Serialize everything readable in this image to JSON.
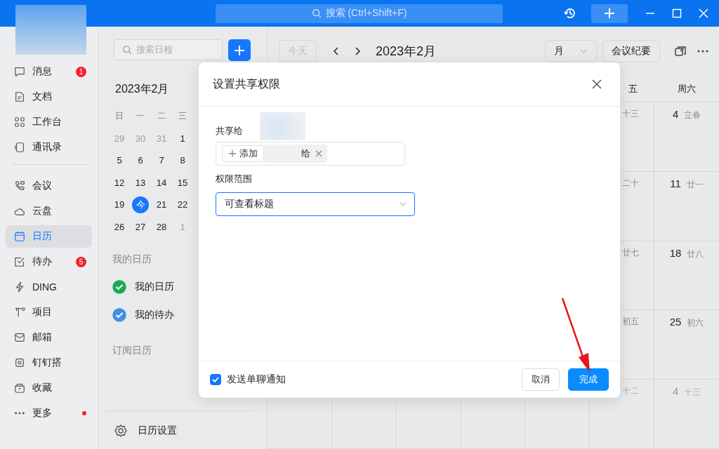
{
  "title_bar": {
    "search_placeholder": "搜索 (Ctrl+Shift+F)"
  },
  "nav_groups": [
    [
      {
        "label": "消息",
        "selected": false,
        "badge": "1",
        "dot": false
      },
      {
        "label": "文档",
        "selected": false,
        "dot": false
      },
      {
        "label": "工作台",
        "selected": false,
        "dot": false
      },
      {
        "label": "通讯录",
        "selected": false,
        "dot": false
      }
    ],
    [
      {
        "label": "会议",
        "selected": false,
        "dot": false
      },
      {
        "label": "云盘",
        "selected": false,
        "dot": false
      },
      {
        "label": "日历",
        "selected": true,
        "dot": false
      },
      {
        "label": "待办",
        "selected": false,
        "badge": "5",
        "dot": false
      },
      {
        "label": "DING",
        "selected": false,
        "dot": false
      },
      {
        "label": "项目",
        "selected": false,
        "dot": false
      },
      {
        "label": "邮箱",
        "selected": false,
        "dot": false
      },
      {
        "label": "钉钉搭",
        "selected": false,
        "dot": false
      },
      {
        "label": "收藏",
        "selected": false,
        "dot": false
      },
      {
        "label": "更多",
        "selected": false,
        "dot": true
      }
    ]
  ],
  "side_panel": {
    "search_placeholder": "搜索日程",
    "mini_calendar": {
      "title": "2023年2月",
      "weekdays": [
        "日",
        "一",
        "二",
        "三"
      ],
      "weeks": [
        [
          {
            "day": "29",
            "muted": true,
            "today": false
          },
          {
            "day": "30",
            "muted": true,
            "today": false
          },
          {
            "day": "31",
            "muted": true,
            "today": false
          },
          {
            "day": "1",
            "muted": false,
            "today": false
          }
        ],
        [
          {
            "day": "5",
            "muted": false,
            "today": false
          },
          {
            "day": "6",
            "muted": false,
            "today": false
          },
          {
            "day": "7",
            "muted": false,
            "today": false
          },
          {
            "day": "8",
            "muted": false,
            "today": false
          }
        ],
        [
          {
            "day": "12",
            "muted": false,
            "today": false
          },
          {
            "day": "13",
            "muted": false,
            "today": false
          },
          {
            "day": "14",
            "muted": false,
            "today": false
          },
          {
            "day": "15",
            "muted": false,
            "today": false
          }
        ],
        [
          {
            "day": "19",
            "muted": false,
            "today": false
          },
          {
            "day": "今",
            "muted": false,
            "today": true
          },
          {
            "day": "21",
            "muted": false,
            "today": false
          },
          {
            "day": "22",
            "muted": false,
            "today": false
          }
        ],
        [
          {
            "day": "26",
            "muted": false,
            "today": false
          },
          {
            "day": "27",
            "muted": false,
            "today": false
          },
          {
            "day": "28",
            "muted": false,
            "today": false
          },
          {
            "day": "1",
            "muted": true,
            "today": false
          }
        ]
      ]
    },
    "my_heading": "我的日历",
    "calendars": [
      {
        "label": "我的日历",
        "checked": true,
        "color": "#1bab56"
      },
      {
        "label": "我的待办",
        "checked": true,
        "color": "#3d8fe8"
      }
    ],
    "subscribed_heading": "订阅日历",
    "settings_label": "日历设置"
  },
  "toolbar": {
    "today": "今天",
    "title": "2023年2月",
    "view": "月",
    "minutes": "会议纪要"
  },
  "grid": {
    "headers": [
      "五",
      "周六"
    ],
    "rows": [
      {
        "cells": [
          {
            "lunar": "十三",
            "muted": false
          },
          {
            "date": "4",
            "lunar": "立春",
            "muted": false
          }
        ]
      },
      {
        "cells": [
          {
            "lunar": "二十",
            "muted": false
          },
          {
            "date": "11",
            "lunar": "廿一",
            "muted": false
          }
        ]
      },
      {
        "cells": [
          {
            "lunar": "廿七",
            "muted": false
          },
          {
            "date": "18",
            "lunar": "廿八",
            "muted": false
          }
        ]
      },
      {
        "cells": [
          {
            "lunar": "初五",
            "muted": false
          },
          {
            "date": "25",
            "lunar": "初六",
            "muted": false
          }
        ]
      },
      {
        "cells": [
          {
            "lunar": "十二",
            "muted": true
          },
          {
            "date": "4",
            "lunar": "十三",
            "muted": true
          }
        ]
      }
    ]
  },
  "dialog": {
    "title": "设置共享权限",
    "share_label": "共享给",
    "add_label": "添加",
    "chip_text": "给",
    "scope_label": "权限范围",
    "scope_value": "可查看标题",
    "notify": {
      "label": "发送单聊通知",
      "checked": true
    },
    "buttons": [
      {
        "label": "取消",
        "kind": "secondary"
      },
      {
        "label": "完成",
        "kind": "primary"
      }
    ]
  }
}
